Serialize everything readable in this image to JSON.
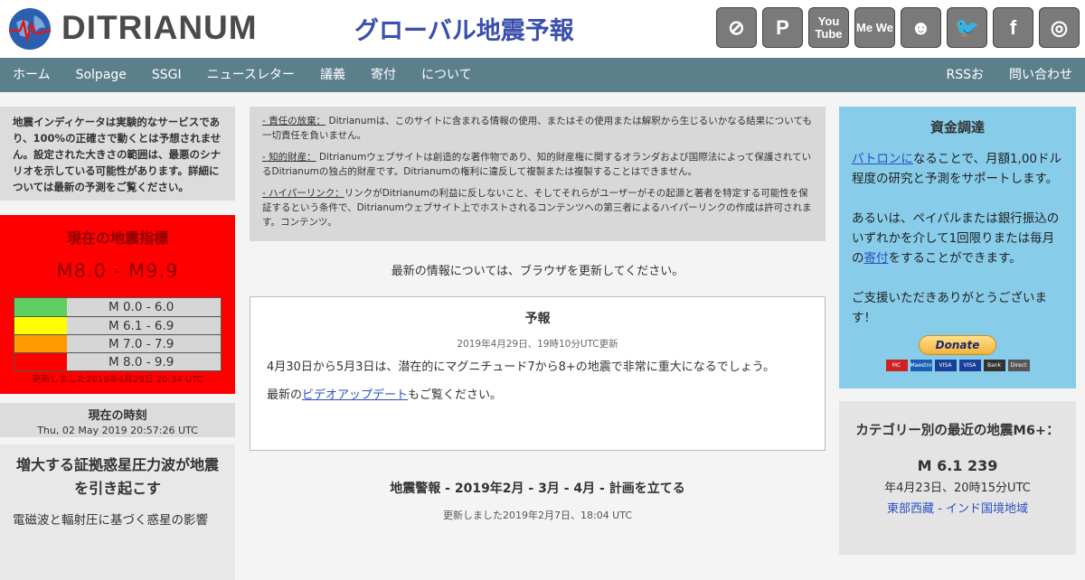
{
  "header": {
    "logo_text": "DITRIANUM",
    "subtitle": "グローバル地震予報",
    "social": [
      {
        "name": "maven-icon",
        "glyph": "⊘"
      },
      {
        "name": "patreon-icon",
        "glyph": "P"
      },
      {
        "name": "youtube-icon",
        "glyph": "You Tube"
      },
      {
        "name": "mewe-icon",
        "glyph": "Me We"
      },
      {
        "name": "reddit-icon",
        "glyph": "☻"
      },
      {
        "name": "twitter-icon",
        "glyph": "🐦"
      },
      {
        "name": "facebook-icon",
        "glyph": "f"
      },
      {
        "name": "instagram-icon",
        "glyph": "◎"
      }
    ]
  },
  "nav": {
    "left": [
      "ホーム",
      "Solpage",
      "SSGI",
      "ニュースレター",
      "議義",
      "寄付",
      "について"
    ],
    "right": [
      "RSSお",
      "問い合わせ"
    ]
  },
  "left": {
    "notice": "地震インディケータは実験的なサービスであり、100%の正確さで動くとは予想されません。設定された大きさの範囲は、最悪のシナリオを示している可能性があります。詳細については最新の予測をご覧ください。",
    "indicator": {
      "title": "現在の地震指標",
      "range": "M8.0 - M9.9",
      "levels": [
        {
          "color": "#5fcf5f",
          "label": "M 0.0 - 6.0"
        },
        {
          "color": "#ffff00",
          "label": "M 6.1 - 6.9"
        },
        {
          "color": "#ff9900",
          "label": "M 7.0 - 7.9"
        },
        {
          "color": "#ff0000",
          "label": "M 8.0 - 9.9"
        }
      ],
      "updated": "更新しました2019年4月29日 20:34 UTC"
    },
    "now": {
      "label": "現在の時刻",
      "value": "Thu, 02 May 2019 20:57:26 UTC"
    },
    "article": {
      "title": "増大する証拠惑星圧力波が地震を引き起こす",
      "body": "電磁波と輻射圧に基づく惑星の影響"
    }
  },
  "center": {
    "disclaimer": [
      {
        "label": "- 責任の放棄：",
        "text": " Ditrianumは、このサイトに含まれる情報の使用、またはその使用または解釈から生じるいかなる結果についても一切責任を負いません。"
      },
      {
        "label": "- 知的財産：",
        "text": " Ditrianumウェブサイトは創造的な著作物であり、知的財産権に関するオランダおよび国際法によって保護されているDitrianumの独占的財産です。Ditrianumの権利に違反して複製または複製することはできません。"
      },
      {
        "label": "- ハイパーリンク：",
        "text": "リンクがDitrianumの利益に反しないこと、そしてそれらがユーザーがその起源と著者を特定する可能性を保証するという条件で、Ditrianumウェブサイト上でホストされるコンテンツへの第三者によるハイパーリンクの作成は許可されます。コンテンツ。"
      }
    ],
    "refresh_note": "最新の情報については、ブラウザを更新してください。",
    "forecast": {
      "title": "予報",
      "updated": "2019年4月29日、19時10分UTC更新",
      "body": "4月30日から5月3日は、潜在的にマグニチュード7から8+の地震で非常に重大になるでしょう。",
      "video_prefix": "最新の",
      "video_link": "ビデオアップデート",
      "video_suffix": "もご覧ください。"
    },
    "article2": {
      "title": "地震警報 - 2019年2月 - 3月 - 4月 - 計画を立てる",
      "updated": "更新しました2019年2月7日、18:04 UTC"
    }
  },
  "right": {
    "funding": {
      "title": "資金調達",
      "p1_link": "パトロンに",
      "p1_text": "なることで、月額1,00ドル程度の研究と予測をサポートします。",
      "p2_prefix": "あるいは、ペイパルまたは銀行振込のいずれかを介して1回限りまたは毎月の",
      "p2_link": "寄付",
      "p2_suffix": "をすることができます。",
      "p3": "ご支援いただきありがとうございます！",
      "donate": "Donate",
      "cards": [
        {
          "label": "MC",
          "color": "#cc2222"
        },
        {
          "label": "Maestro",
          "color": "#1a5fb4"
        },
        {
          "label": "VISA",
          "color": "#1a3f99"
        },
        {
          "label": "VISA",
          "color": "#1a3f99"
        },
        {
          "label": "Bank",
          "color": "#333333"
        },
        {
          "label": "Direct",
          "color": "#555555"
        }
      ]
    },
    "recent": {
      "title": "カテゴリー別の最近の地震M6+：",
      "magnitude": "M 6.1 239",
      "date": "年4月23日、20時15分UTC",
      "region": "東部西藏 - インド国境地域"
    }
  }
}
